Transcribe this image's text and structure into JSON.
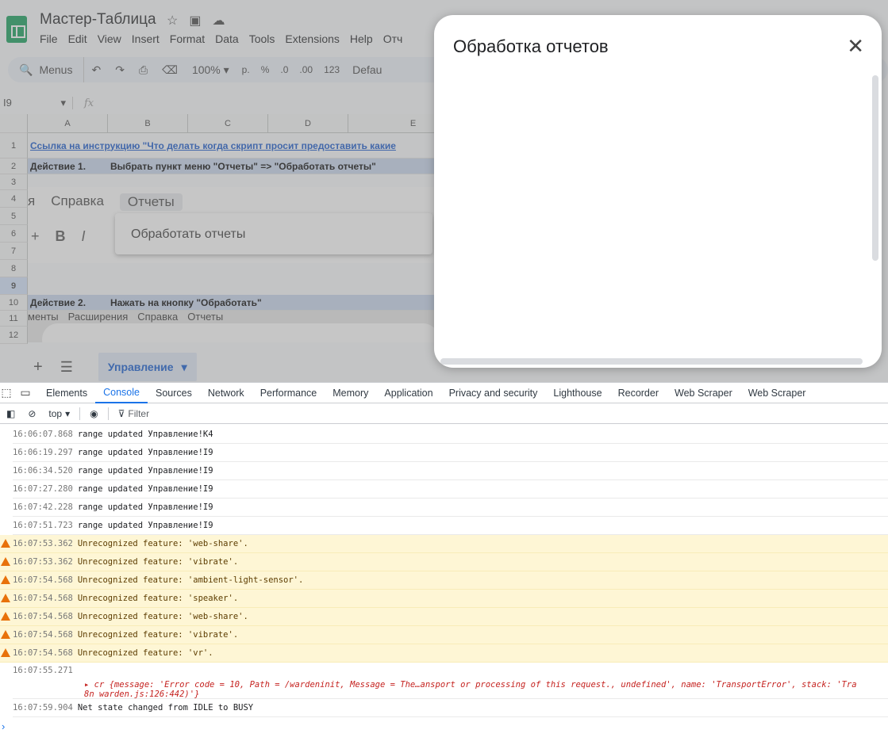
{
  "app": {
    "doc_title": "Мастер-Таблица",
    "menu": [
      "File",
      "Edit",
      "View",
      "Insert",
      "Format",
      "Data",
      "Tools",
      "Extensions",
      "Help",
      "Отч"
    ]
  },
  "toolbar": {
    "search_label": "Menus",
    "zoom": "100%",
    "currency": "р.",
    "percent": "%",
    "dec_decrease": ".0",
    "dec_increase": ".00",
    "number_format": "123",
    "font": "Defau"
  },
  "formula_bar": {
    "cell_ref": "I9",
    "fx_icon": "fx"
  },
  "columns": [
    "A",
    "B",
    "C",
    "D",
    "E"
  ],
  "rows": [
    "1",
    "2",
    "3",
    "4",
    "5",
    "6",
    "7",
    "8",
    "9",
    "10",
    "11",
    "12"
  ],
  "cells": {
    "r1": "Ссылка на инструкцию \"Что делать когда скрипт просит предоставить какие",
    "r2_step": "Действие 1.",
    "r2_text": "Выбрать пункт меню \"Отчеты\" => \"Обработать отчеты\"",
    "r10_step": "Действие 2.",
    "r10_text": "Нажать на кнопку \"Обработать\""
  },
  "embedded1": {
    "menu_partial": "я",
    "menu_help": "Справка",
    "menu_reports": "Отчеты",
    "dropdown_item": "Обработать отчеты",
    "tool_plus": "+",
    "tool_bold": "B",
    "tool_italic": "I"
  },
  "embedded2": {
    "menu": [
      "менты",
      "Расширения",
      "Справка",
      "Отчеты"
    ]
  },
  "sheet_tabs": {
    "active": "Управление"
  },
  "dialog": {
    "title": "Обработка отчетов",
    "close_icon": "✕"
  },
  "devtools": {
    "tabs": [
      "Elements",
      "Console",
      "Sources",
      "Network",
      "Performance",
      "Memory",
      "Application",
      "Privacy and security",
      "Lighthouse",
      "Recorder",
      "Web Scraper",
      "Web Scraper"
    ],
    "context": "top",
    "filter_placeholder": "Filter"
  },
  "console_logs": [
    {
      "ts": "16:06:07.868",
      "msg": "range updated Управление!K4",
      "level": "info"
    },
    {
      "ts": "16:06:19.297",
      "msg": "range updated Управление!I9",
      "level": "info"
    },
    {
      "ts": "16:06:34.520",
      "msg": "range updated Управление!I9",
      "level": "info"
    },
    {
      "ts": "16:07:27.280",
      "msg": "range updated Управление!I9",
      "level": "info"
    },
    {
      "ts": "16:07:42.228",
      "msg": "range updated Управление!I9",
      "level": "info"
    },
    {
      "ts": "16:07:51.723",
      "msg": "range updated Управление!I9",
      "level": "info"
    },
    {
      "ts": "16:07:53.362",
      "msg": "Unrecognized feature: 'web-share'.",
      "level": "warn"
    },
    {
      "ts": "16:07:53.362",
      "msg": "Unrecognized feature: 'vibrate'.",
      "level": "warn"
    },
    {
      "ts": "16:07:54.568",
      "msg": "Unrecognized feature: 'ambient-light-sensor'.",
      "level": "warn"
    },
    {
      "ts": "16:07:54.568",
      "msg": "Unrecognized feature: 'speaker'.",
      "level": "warn"
    },
    {
      "ts": "16:07:54.568",
      "msg": "Unrecognized feature: 'web-share'.",
      "level": "warn"
    },
    {
      "ts": "16:07:54.568",
      "msg": "Unrecognized feature: 'vibrate'.",
      "level": "warn"
    },
    {
      "ts": "16:07:54.568",
      "msg": "Unrecognized feature: 'vr'.",
      "level": "warn"
    }
  ],
  "error_log": {
    "ts": "16:07:55.271",
    "line1": "▸ cr {message: 'Error code = 10, Path = /wardeninit, Message = The…ansport or processing of this request., undefined', name: 'TransportError', stack: 'Tra",
    "line2": "8n_warden.js:126:442)'}"
  },
  "last_log": {
    "ts": "16:07:59.904",
    "msg": "Net state changed from IDLE to BUSY"
  },
  "prompt_symbol": "›"
}
